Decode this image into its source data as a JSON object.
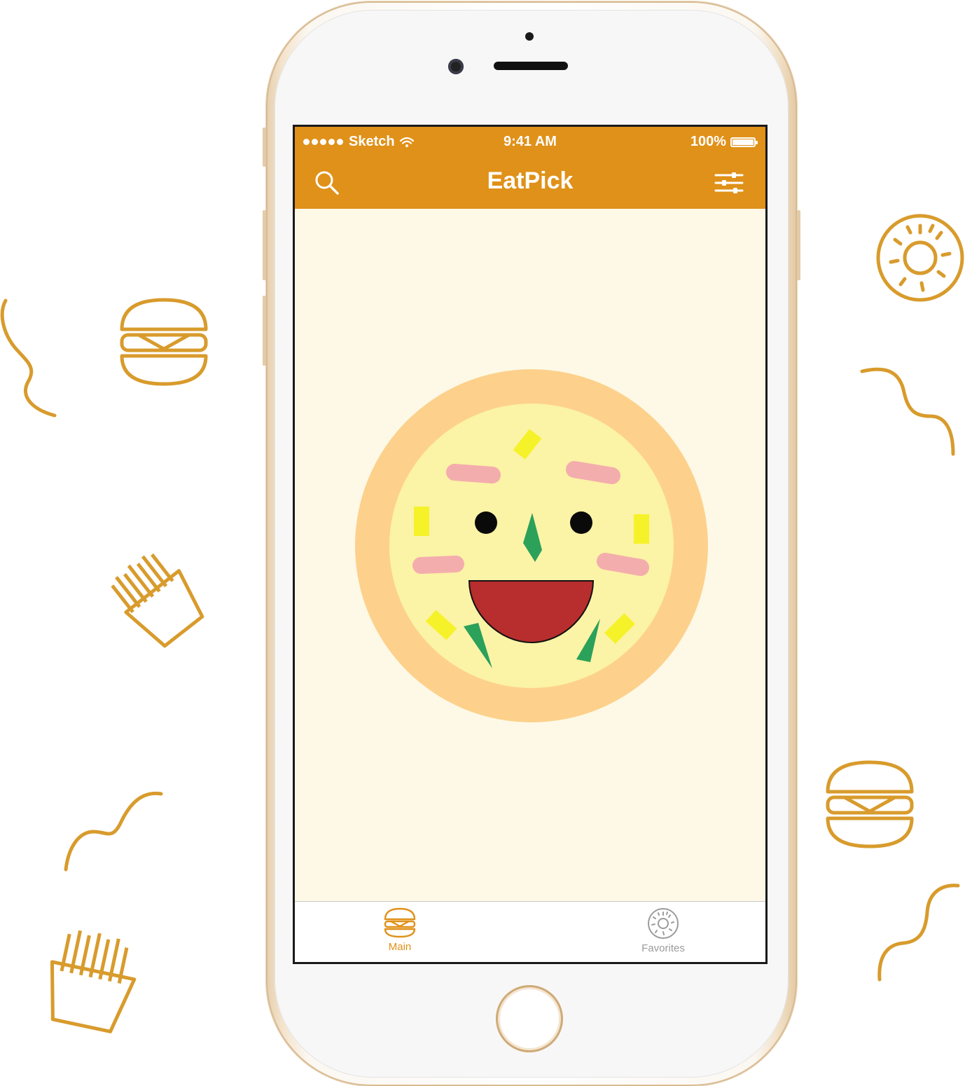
{
  "colors": {
    "accent": "#e09119",
    "screen_bg": "#fdf9e6",
    "doodle": "#d89b2c",
    "tab_inactive": "#9b9b9b"
  },
  "status_bar": {
    "carrier": "Sketch",
    "time": "9:41 AM",
    "battery": "100%"
  },
  "nav_bar": {
    "title": "EatPick",
    "left_icon": "search-icon",
    "right_icon": "filter-sliders-icon"
  },
  "main": {
    "illustration": "pizza-face-icon"
  },
  "tab_bar": {
    "tabs": [
      {
        "label": "Main",
        "icon": "burger-icon",
        "selected": true
      },
      {
        "label": "Favorites",
        "icon": "donut-icon",
        "selected": false
      }
    ]
  }
}
